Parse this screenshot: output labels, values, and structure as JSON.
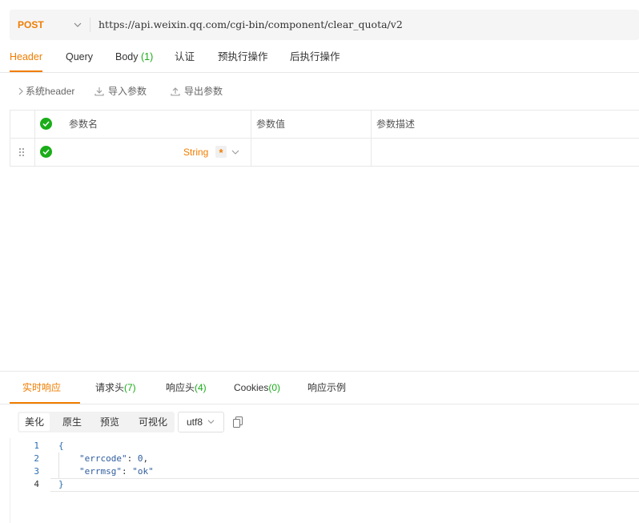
{
  "request": {
    "method": "POST",
    "url": "https://api.weixin.qq.com/cgi-bin/component/clear_quota/v2"
  },
  "tabs": [
    {
      "label": "Header",
      "count": ""
    },
    {
      "label": "Query",
      "count": ""
    },
    {
      "label": "Body ",
      "count": "(1)"
    },
    {
      "label": "认证",
      "count": ""
    },
    {
      "label": "预执行操作",
      "count": ""
    },
    {
      "label": "后执行操作",
      "count": ""
    }
  ],
  "toolbar": {
    "system_header": "系统header",
    "import_params": "导入参数",
    "export_params": "导出参数"
  },
  "table": {
    "headers": {
      "name": "参数名",
      "value": "参数值",
      "desc": "参数描述"
    },
    "rows": [
      {
        "name": "",
        "type": "String",
        "required": "*",
        "value": "",
        "desc": ""
      }
    ]
  },
  "response": {
    "tabs": [
      {
        "label": "实时响应",
        "count": ""
      },
      {
        "label": "请求头",
        "count": "(7)"
      },
      {
        "label": "响应头",
        "count": "(4)"
      },
      {
        "label": "Cookies",
        "count": "(0)"
      },
      {
        "label": "响应示例",
        "count": ""
      }
    ],
    "view_modes": [
      "美化",
      "原生",
      "预览",
      "可视化"
    ],
    "encoding": "utf8",
    "line_numbers": [
      "1",
      "2",
      "3",
      "4"
    ],
    "body": {
      "open": "{",
      "close": "}",
      "errcode_key": "\"errcode\"",
      "errcode_val": "0",
      "errmsg_key": "\"errmsg\"",
      "errmsg_val": "\"ok\""
    }
  },
  "colors": {
    "accent": "#f07d00",
    "success": "#1aad19",
    "code_blue": "#2f5d9f"
  }
}
